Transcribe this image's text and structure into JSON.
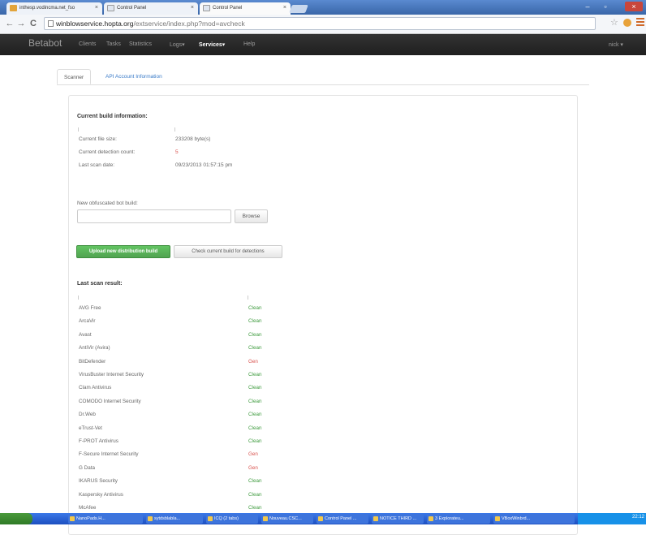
{
  "browser": {
    "tabs": [
      {
        "label": "inthesp.vodincma.net_fso"
      },
      {
        "label": "Control Panel"
      },
      {
        "label": "Control Panel"
      }
    ],
    "url_host": "winblowservice.hopta.org",
    "url_path": "/extservice/index.php?mod=avcheck"
  },
  "navbar": {
    "brand": "Betabot",
    "links": [
      "Clients",
      "Tasks",
      "Statistics",
      "Logs▾",
      "Services▾",
      "Help"
    ],
    "active": "Services▾",
    "user": "nick ▾"
  },
  "tabs": {
    "scanner": "Scanner",
    "api": "API Account Information"
  },
  "build_info": {
    "heading": "Current build information:",
    "rows": [
      {
        "label": "Current file size:",
        "value": "233208 byte(s)"
      },
      {
        "label": "Current detection count:",
        "value": "5"
      },
      {
        "label": "Last scan date:",
        "value": "09/23/2013 01:57:15 pm"
      }
    ]
  },
  "upload": {
    "label": "New obfuscated bot build:",
    "file_value": "",
    "browse_label": "Browse",
    "upload_label": "Upload new distribution build",
    "check_label": "Check current build for detections"
  },
  "results": {
    "heading": "Last scan result:",
    "rows": [
      {
        "name": "AVG Free",
        "result": "Clean"
      },
      {
        "name": "ArcaVir",
        "result": "Clean"
      },
      {
        "name": "Avast",
        "result": "Clean"
      },
      {
        "name": "AntiVir (Avira)",
        "result": "Clean"
      },
      {
        "name": "BitDefender",
        "result": "Gen"
      },
      {
        "name": "VirusBuster Internet Security",
        "result": "Clean"
      },
      {
        "name": "Clam Antivirus",
        "result": "Clean"
      },
      {
        "name": "COMODO Internet Security",
        "result": "Clean"
      },
      {
        "name": "Dr.Web",
        "result": "Clean"
      },
      {
        "name": "eTrust-Vet",
        "result": "Clean"
      },
      {
        "name": "F-PROT Antivirus",
        "result": "Clean"
      },
      {
        "name": "F-Secure Internet Security",
        "result": "Gen"
      },
      {
        "name": "G Data",
        "result": "Gen"
      },
      {
        "name": "IKARUS Security",
        "result": "Clean"
      },
      {
        "name": "Kaspersky Antivirus",
        "result": "Clean"
      },
      {
        "name": "McAfee",
        "result": "Clean"
      }
    ]
  },
  "taskbar": {
    "items": [
      "NanoPads.H...",
      "sytdsblabla...",
      "ICQ (2 tabs)",
      "Nouveau.CSC...",
      "Control Panel ...",
      "NOTICE THIRD ...",
      "3 Explorateu...",
      "VBoxWinbrd..."
    ],
    "clock": "22:12"
  },
  "colors": {
    "clean": "#3c9a3c",
    "detected": "#d9534f",
    "upload_button": "#51a351",
    "navbar": "#262626"
  }
}
